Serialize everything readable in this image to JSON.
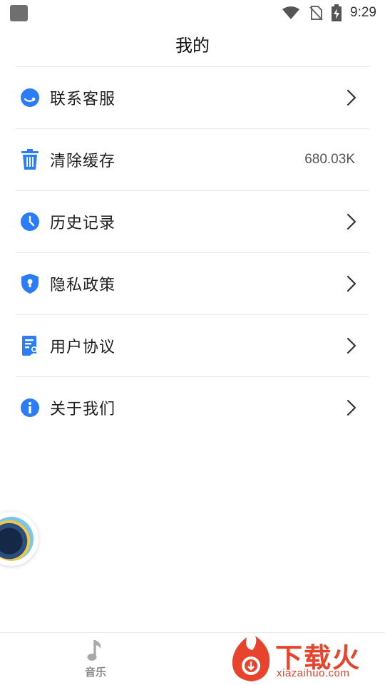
{
  "status_bar": {
    "time": "9:29",
    "icons": [
      "app-square-icon",
      "wifi-icon",
      "no-sim-icon",
      "battery-charging-icon"
    ]
  },
  "page": {
    "title": "我的"
  },
  "menu": {
    "items": [
      {
        "label": "联系客服",
        "icon": "customer-service-icon",
        "right": "chevron-right-icon"
      },
      {
        "label": "清除缓存",
        "icon": "trash-icon",
        "value": "680.03K"
      },
      {
        "label": "历史记录",
        "icon": "clock-icon",
        "right": "chevron-right-icon"
      },
      {
        "label": "隐私政策",
        "icon": "shield-icon",
        "right": "chevron-right-icon"
      },
      {
        "label": "用户协议",
        "icon": "document-user-icon",
        "right": "chevron-right-icon"
      },
      {
        "label": "关于我们",
        "icon": "info-icon",
        "right": "chevron-right-icon"
      }
    ]
  },
  "bottom_nav": {
    "music_label": "音乐",
    "music_icon": "music-note-icon"
  },
  "watermark": {
    "text": "下载火",
    "sub": "xiazaihuo.com"
  },
  "colors": {
    "accent_blue": "#2b7cf6",
    "text_primary": "#1f1f1f",
    "text_secondary": "#555555",
    "divider": "#e9e9e9",
    "watermark_red": "#e8442d"
  }
}
